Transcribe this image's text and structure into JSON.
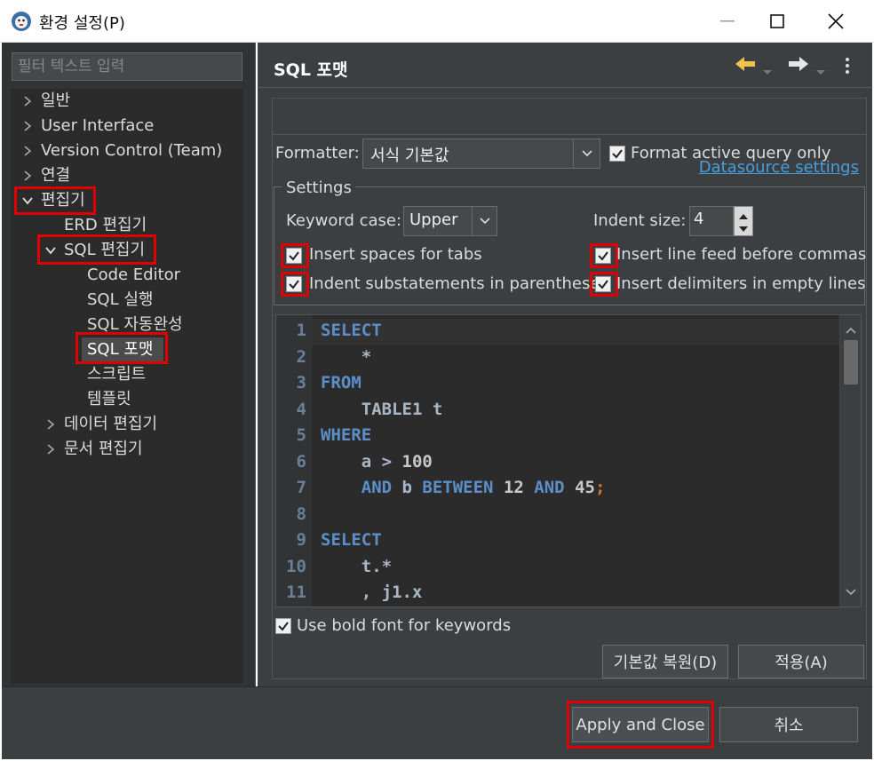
{
  "window": {
    "title": "환경 설정(P)"
  },
  "filter": {
    "placeholder": "필터 텍스트 입력"
  },
  "tree": {
    "items": [
      {
        "label": "일반"
      },
      {
        "label": "User Interface"
      },
      {
        "label": "Version Control (Team)"
      },
      {
        "label": "연결"
      },
      {
        "label": "편집기"
      },
      {
        "label": "ERD 편집기"
      },
      {
        "label": "SQL 편집기"
      },
      {
        "label": "Code Editor"
      },
      {
        "label": "SQL 실행"
      },
      {
        "label": "SQL 자동완성"
      },
      {
        "label": "SQL 포맷"
      },
      {
        "label": "스크립트"
      },
      {
        "label": "템플릿"
      },
      {
        "label": "데이터 편집기"
      },
      {
        "label": "문서 편집기"
      }
    ]
  },
  "page": {
    "title": "SQL 포맷",
    "datasource_link": "Datasource settings",
    "formatter_label": "Formatter:",
    "formatter_value": "서식 기본값",
    "format_active_only": "Format active query only",
    "settings_legend": "Settings",
    "keyword_case_label": "Keyword case:",
    "keyword_case_value": "Upper",
    "indent_size_label": "Indent size:",
    "indent_size_value": "4",
    "opt_spaces_tabs": "Insert spaces for tabs",
    "opt_line_feed_commas": "Insert line feed before commas",
    "opt_indent_sub": "Indent substatements in parentheses",
    "opt_delim_empty": "Insert delimiters in empty lines",
    "bold_keywords": "Use bold font for keywords",
    "restore_defaults": "기본값 복원(D)",
    "apply": "적용(A)"
  },
  "code_lines": [
    "1",
    "2",
    "3",
    "4",
    "5",
    "6",
    "7",
    "8",
    "9",
    "10",
    "11"
  ],
  "footer": {
    "apply_close": "Apply and Close",
    "cancel": "취소"
  },
  "colors": {
    "keyword": "#5c8fca",
    "highlight_border": "#e00000",
    "link": "#4a9eda"
  }
}
